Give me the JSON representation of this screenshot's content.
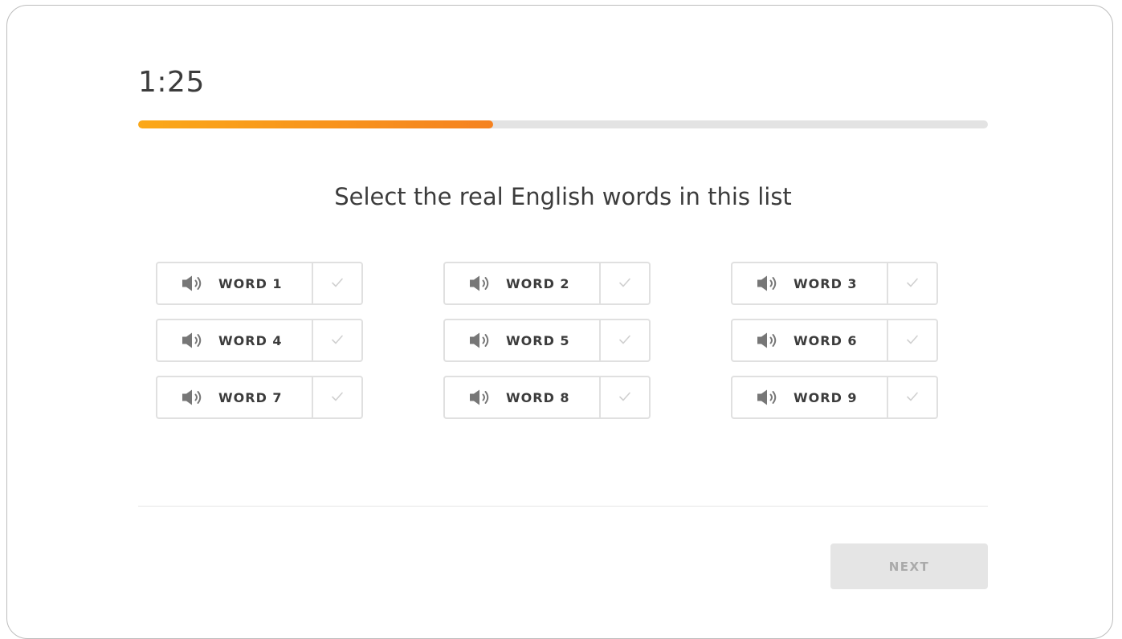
{
  "timer": "1:25",
  "progress": {
    "fraction": 0.418
  },
  "question": "Select the real English words in this list",
  "words": [
    {
      "label": "WORD 1"
    },
    {
      "label": "WORD 2"
    },
    {
      "label": "WORD 3"
    },
    {
      "label": "WORD 4"
    },
    {
      "label": "WORD 5"
    },
    {
      "label": "WORD 6"
    },
    {
      "label": "WORD 7"
    },
    {
      "label": "WORD 8"
    },
    {
      "label": "WORD 9"
    }
  ],
  "icons": {
    "speaker": "speaker-icon",
    "check": "checkmark-icon"
  },
  "colors": {
    "progress_start": "#fba818",
    "progress_end": "#f58220",
    "track": "#e3e3e3",
    "disabled_button": "#e5e5e5"
  },
  "next_label": "NEXT"
}
